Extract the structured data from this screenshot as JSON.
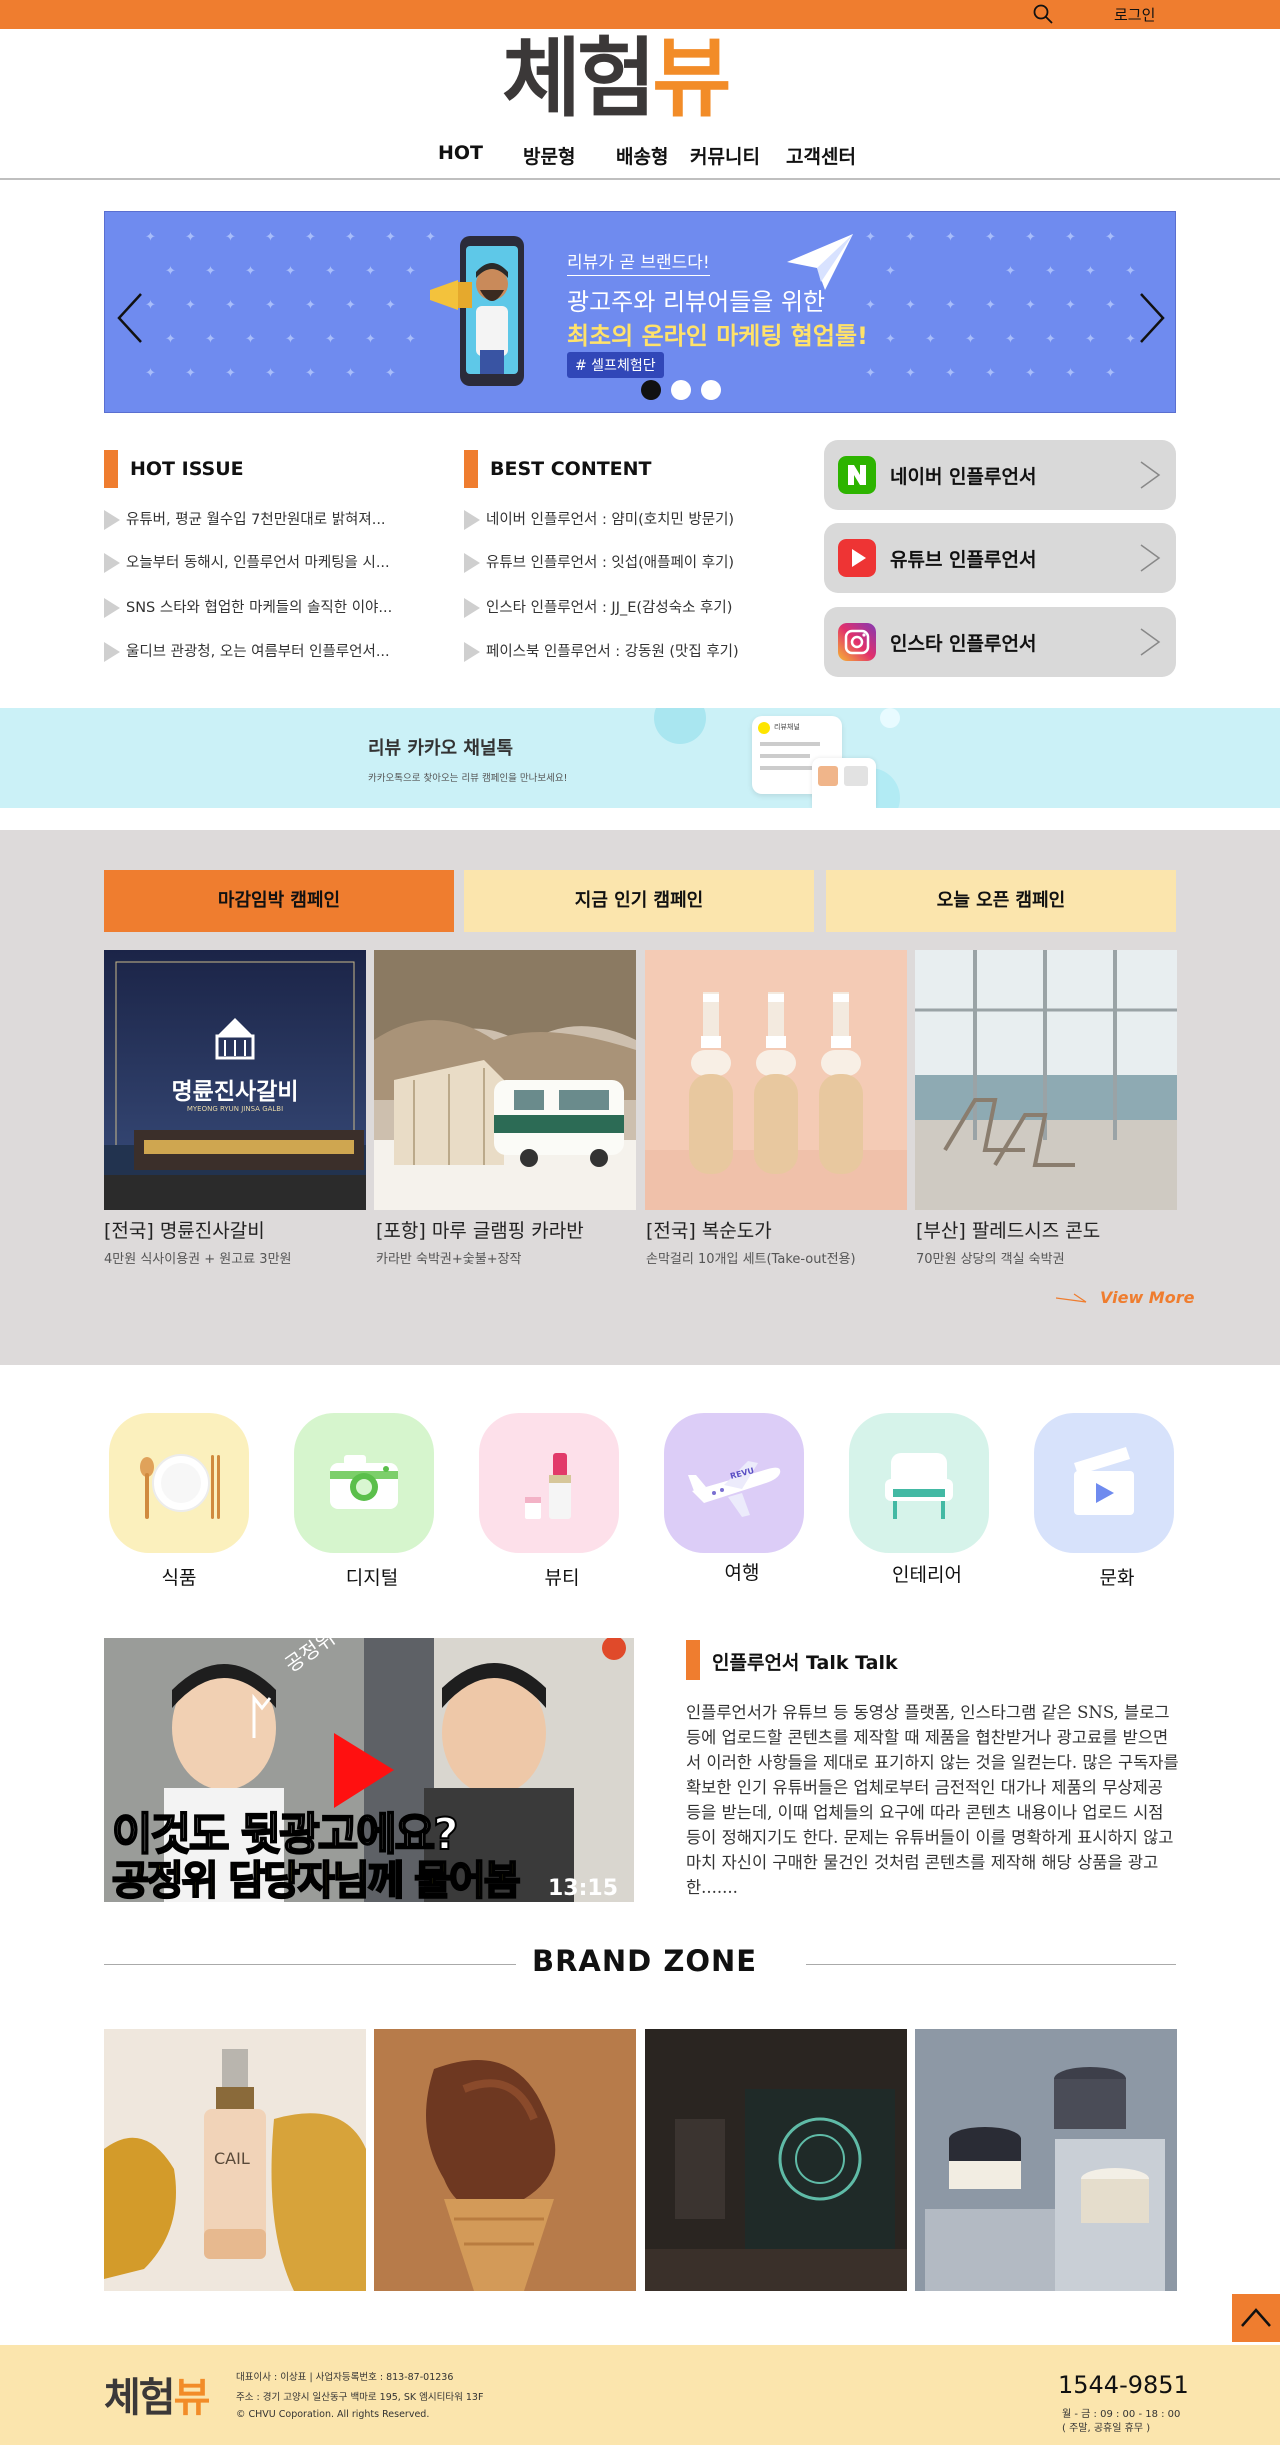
{
  "topbar": {
    "login": "로그인",
    "search_icon": "search-icon"
  },
  "logo": {
    "part1": "체험",
    "part2": "뷰"
  },
  "nav": {
    "items": [
      "HOT",
      "방문형",
      "배송형",
      "커뮤니티",
      "고객센터"
    ]
  },
  "hero": {
    "subtitle": "리뷰가 곧 브랜드다!",
    "line1": "광고주와 리뷰어들을 위한",
    "line2": "최초의 온라인 마케팅 협업툴!",
    "tag": "# 셀프체험단",
    "active_slide": 1,
    "slide_count": 3
  },
  "hot_issue": {
    "title": "HOT ISSUE",
    "items": [
      "유튜버, 평균 월수입 7천만원대로 밝혀져...",
      "오늘부터 동해시, 인플루언서 마케팅을 시...",
      "SNS 스타와 협업한 마케들의 솔직한 이야...",
      "울디브 관광청, 오는 여름부터 인플루언서..."
    ]
  },
  "best_content": {
    "title": "BEST CONTENT",
    "items": [
      "네이버 인플루언서 : 얌미(호치민 방문기)",
      "유튜브 인플루언서 : 잇섭(애플페이 후기)",
      "인스타 인플루언서 : JJ_E(감성숙소 후기)",
      "페이스북 인플루언서 : 강동원 (맛집 후기)"
    ]
  },
  "influencers": [
    {
      "label": "네이버 인플루언서",
      "icon": "naver-icon",
      "color": "#2db400"
    },
    {
      "label": "유튜브 인플루언서",
      "icon": "youtube-icon",
      "color": "#ee3434"
    },
    {
      "label": "인스타 인플루언서",
      "icon": "instagram-icon",
      "color": "#d6298a"
    }
  ],
  "kakao": {
    "title": "리뷰 카카오 채널톡",
    "subtitle": "카카오톡으로 찾아오는 리뷰 캠페인을 만나보세요!",
    "card_title": "리뷰채널"
  },
  "campaign": {
    "tabs": [
      "마감임박 캠페인",
      "지금 인기 캠페인",
      "오늘 오픈 캠페인"
    ],
    "active_tab": 0,
    "items": [
      {
        "title": "[전국] 명륜진사갈비",
        "sub": "4만원 식사이용권 + 원고료 3만원",
        "image_text": "명륜진사갈비",
        "image_text_en": "MYEONG RYUN JINSA GALBI"
      },
      {
        "title": "[포항] 마루 글램핑 카라반",
        "sub": "카라반 숙박권+숯불+장작"
      },
      {
        "title": "[전국] 복순도가",
        "sub": "손막걸리 10개입 세트(Take-out전용)"
      },
      {
        "title": "[부산] 팔레드시즈 콘도",
        "sub": "70만원 상당의 객실 숙박권"
      }
    ],
    "view_more": "View More"
  },
  "categories": [
    {
      "label": "식품",
      "icon": "food-plate-icon",
      "bg": "#fbf0bd"
    },
    {
      "label": "디지털",
      "icon": "camera-icon",
      "bg": "#d6f5cd"
    },
    {
      "label": "뷰티",
      "icon": "lipstick-icon",
      "bg": "#fde0ea"
    },
    {
      "label": "여행",
      "icon": "airplane-icon",
      "bg": "#dccdf7",
      "plane_text": "REVU"
    },
    {
      "label": "인테리어",
      "icon": "armchair-icon",
      "bg": "#d6f3ea"
    },
    {
      "label": "문화",
      "icon": "clapperboard-icon",
      "bg": "#d7e2fb"
    }
  ],
  "video": {
    "caption1": "이것도 뒷광고에요?",
    "caption2": "공정위 담당자님께 물어봄",
    "duration": "13:15",
    "handwriting": "공정위 담당자님"
  },
  "talk": {
    "title": "인플루언서 Talk Talk",
    "body": "인플루언서가 유튜브 등 동영상 플랫폼, 인스타그램 같은 SNS, 블로그 등에 업로드할 콘텐츠를 제작할 때 제품을 협찬받거나 광고료를 받으면서 이러한 사항들을 제대로 표기하지 않는 것을 일컫는다. 많은 구독자를 확보한 인기 유튜버들은 업체로부터 금전적인 대가나 제품의 무상제공 등을 받는데, 이때 업체들의 요구에 따라 콘텐츠 내용이나 업로드 시점 등이 정해지기도 한다. 문제는 유튜버들이 이를 명확하게 표시하지 않고 마치 자신이 구매한 물건인 것처럼 콘텐츠를 제작해 해당 상품을 광고한......."
  },
  "brand_zone": {
    "title": "BRAND ZONE",
    "bottle_text": "CAIL"
  },
  "footer": {
    "logo1": "체험",
    "logo2": "뷰",
    "info1": "대표이사 : 이상표 | 사업자등록번호 : 813-87-01236",
    "info2": "주소 : 경기 고양시 일산동구 백마로 195, SK 엠시티타워 13F",
    "info3": "© CHVU Coporation. All rights Reserved.",
    "phone": "1544-9851",
    "hours1": "월 - 금 : 09 : 00 - 18 : 00",
    "hours2": "( 주말, 공휴일 휴무 )"
  }
}
